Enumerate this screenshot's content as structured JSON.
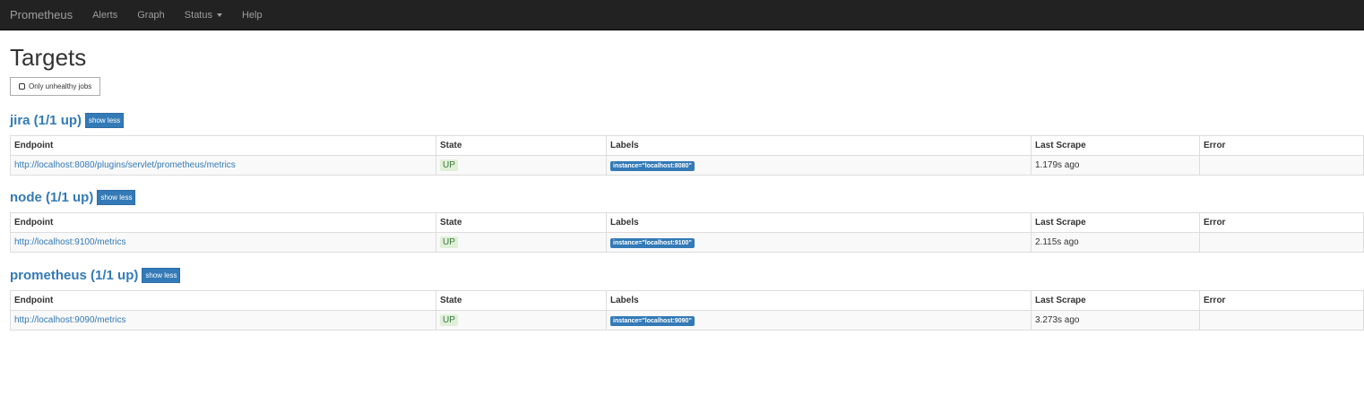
{
  "navbar": {
    "brand": "Prometheus",
    "items": [
      "Alerts",
      "Graph",
      "Status",
      "Help"
    ]
  },
  "page": {
    "title": "Targets",
    "filter_label": "Only unhealthy jobs"
  },
  "table_headers": [
    "Endpoint",
    "State",
    "Labels",
    "Last Scrape",
    "Error"
  ],
  "jobs": [
    {
      "title": "jira (1/1 up)",
      "toggle_label": "show less",
      "endpoint": "http://localhost:8080/plugins/servlet/prometheus/metrics",
      "state": "UP",
      "label": "instance=\"localhost:8080\"",
      "last_scrape": "1.179s ago",
      "error": ""
    },
    {
      "title": "node (1/1 up)",
      "toggle_label": "show less",
      "endpoint": "http://localhost:9100/metrics",
      "state": "UP",
      "label": "instance=\"localhost:9100\"",
      "last_scrape": "2.115s ago",
      "error": ""
    },
    {
      "title": "prometheus (1/1 up)",
      "toggle_label": "show less",
      "endpoint": "http://localhost:9090/metrics",
      "state": "UP",
      "label": "instance=\"localhost:9090\"",
      "last_scrape": "3.273s ago",
      "error": ""
    }
  ],
  "colors": {
    "navbar_bg": "#222222",
    "link": "#337ab7",
    "up_bg": "#dff0d8",
    "up_text": "#3c763d"
  }
}
